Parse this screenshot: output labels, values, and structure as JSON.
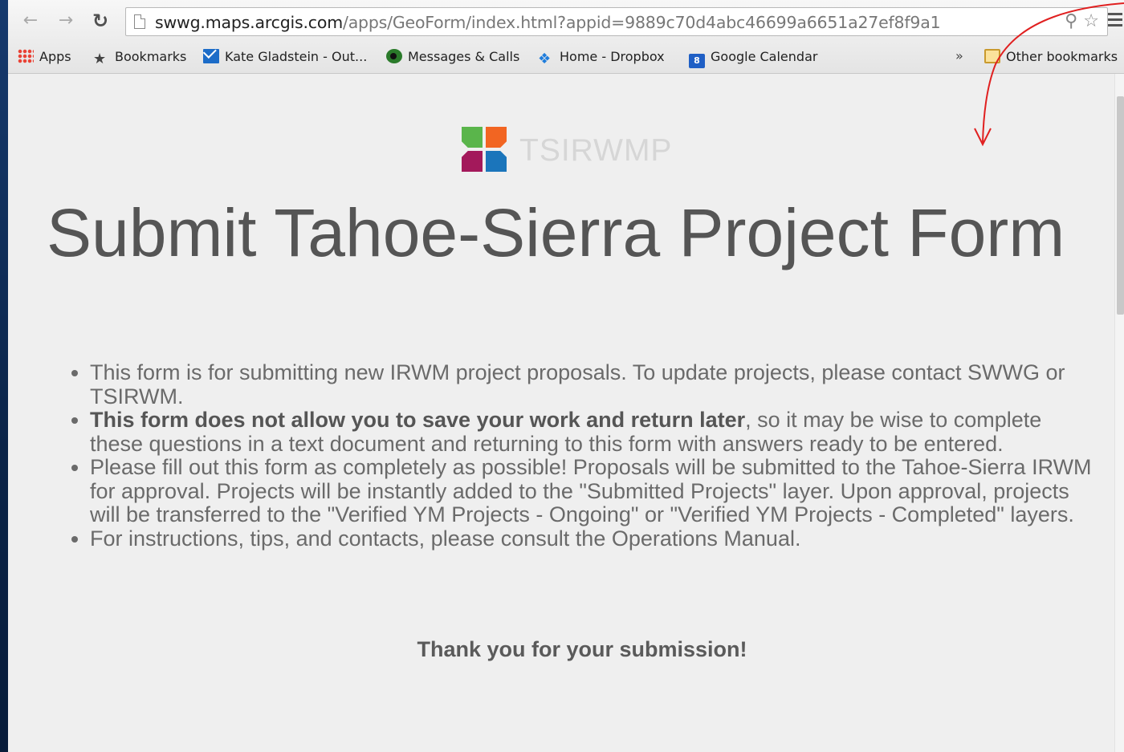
{
  "browser": {
    "url_host": "swwg.maps.arcgis.com",
    "url_path": "/apps/GeoForm/index.html?appid=9889c70d4abc46699a6651a27ef8f9a1",
    "bookmarks": [
      {
        "label": "Apps",
        "icon": "apps-grid-icon"
      },
      {
        "label": "Bookmarks",
        "icon": "star-icon"
      },
      {
        "label": "Kate Gladstein - Out...",
        "icon": "mail-icon"
      },
      {
        "label": "Messages & Calls",
        "icon": "messages-icon"
      },
      {
        "label": "Home - Dropbox",
        "icon": "dropbox-icon"
      },
      {
        "label": "Google Calendar",
        "icon": "calendar-icon",
        "badge": "8"
      }
    ],
    "overflow_label": "»",
    "other_bookmarks": "Other bookmarks"
  },
  "page": {
    "logo_text": "TSIRWMP",
    "title": "Submit Tahoe-Sierra Project Form",
    "notes": {
      "item1": "This form is for submitting new IRWM project proposals. To update projects, please contact SWWG or TSIRWM.",
      "item2_bold": "This form does not allow you to save your work and return later",
      "item2_rest": ", so it may be wise to complete these questions in a text document and returning to this form with answers ready to be entered.",
      "item3": "Please fill out this form as completely as possible! Proposals will be submitted to the Tahoe-Sierra IRWM for approval. Projects will be instantly added to the \"Submitted Projects\" layer. Upon approval, projects will be transferred to the \"Verified YM Projects - Ongoing\" or \"Verified YM Projects - Completed\" layers.",
      "item4": "For instructions, tips, and contacts, please consult the Operations Manual."
    },
    "thanks": "Thank you for your submission!"
  },
  "colors": {
    "annotation_arrow": "#e02020",
    "logo_green": "#5ab54b",
    "logo_orange": "#f26522",
    "logo_magenta": "#a3195b",
    "logo_blue": "#1b75bb"
  }
}
